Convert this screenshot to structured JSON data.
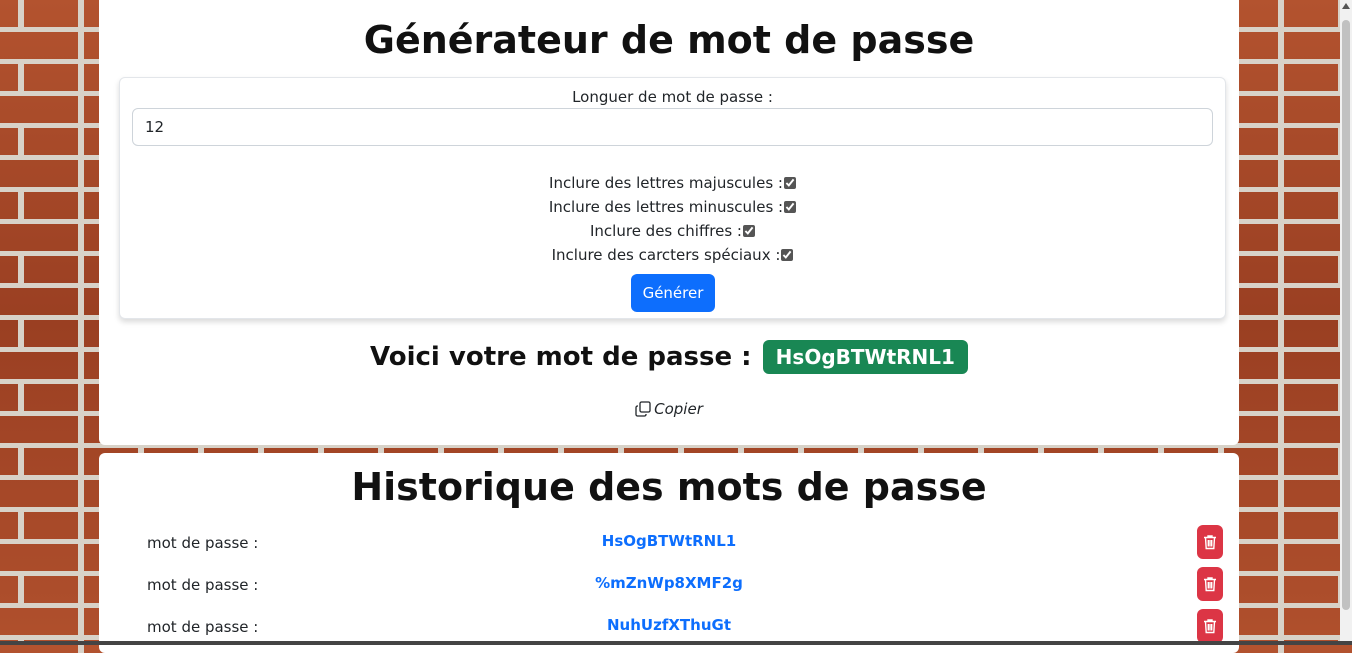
{
  "generator": {
    "title": "Générateur de mot de passe",
    "length_label": "Longuer de mot de passe :",
    "length_value": "12",
    "options": [
      {
        "label": "Inclure des lettres majuscules :",
        "checked": true
      },
      {
        "label": "Inclure des lettres minuscules :",
        "checked": true
      },
      {
        "label": "Inclure des chiffres :",
        "checked": true
      },
      {
        "label": "Inclure des carcters spéciaux :",
        "checked": true
      }
    ],
    "generate_label": "Générer"
  },
  "result": {
    "label": "Voici votre mot de passe :",
    "password": "HsOgBTWtRNL1",
    "copy_label": "Copier"
  },
  "history": {
    "title": "Historique des mots de passe",
    "items": [
      {
        "label": "mot de passe :",
        "value": "HsOgBTWtRNL1"
      },
      {
        "label": "mot de passe :",
        "value": "%mZnWp8XMF2g"
      },
      {
        "label": "mot de passe :",
        "value": "NuhUzfXThuGt"
      }
    ]
  },
  "colors": {
    "primary": "#0d6efd",
    "success": "#198754",
    "danger": "#dc3545"
  }
}
